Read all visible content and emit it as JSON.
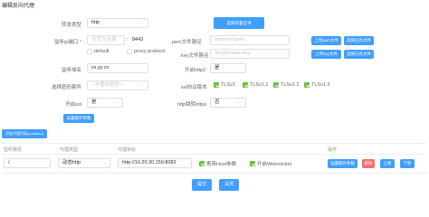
{
  "title": "编辑反向代理",
  "form": {
    "forward_type_label": "转发类型",
    "forward_type_value": "http",
    "select_builtin_cert": "选择内置证书",
    "listen_label": "监听ip端口",
    "listen_required": "*",
    "listen_ip_placeholder": "为空为全部",
    "listen_sep": ":",
    "listen_port": "8443",
    "pem_label": "pem文件路径",
    "pem_placeholder": "/tmp/cert.pem",
    "pem_upload": "上传pem文件",
    "pem_choose": "选择已有文件",
    "default_label": "default",
    "proxy_protocol_label": "proxy protocol",
    "key_label": "key文件路径",
    "key_placeholder": "/tmp/private.key",
    "key_upload": "上传key文件",
    "key_choose": "选择已有文件",
    "domain_label": "监听域名",
    "domain_value": "xx.yy.cn",
    "http2_label": "开启http2",
    "http2_value": "是",
    "cipher_label": "选择密码套件",
    "cipher_placeholder": "--不使用密码--",
    "ssl_label": "ssl协议版本",
    "ssl_options": [
      "TLSv1",
      "TLSv1.1",
      "TLSv1.2",
      "TLSv1.3"
    ],
    "enable_ssl_label": "开启ssl",
    "enable_ssl_value": "是",
    "https_label": "http跳转https",
    "https_value": "否",
    "extra_params_button": "设置额外参数"
  },
  "add_location_button": "添加代理目标(Location)",
  "table": {
    "headers": [
      "监听路径",
      "代理类型",
      "代理目标",
      "操作"
    ],
    "row": {
      "path": "/",
      "type": "动态http",
      "target": "http://10.20.30.150:8082",
      "carry_host": "携带Host参数",
      "websocket": "开启Websocket",
      "set_params": "设置额外参数",
      "delete": "删除",
      "up": "上移",
      "down": "下移"
    }
  },
  "footer": {
    "submit": "提交",
    "close": "关闭"
  },
  "colors": {
    "primary": "#409eff",
    "danger": "#f56c6c",
    "success": "#67c23a",
    "border": "#dcdfe6"
  }
}
